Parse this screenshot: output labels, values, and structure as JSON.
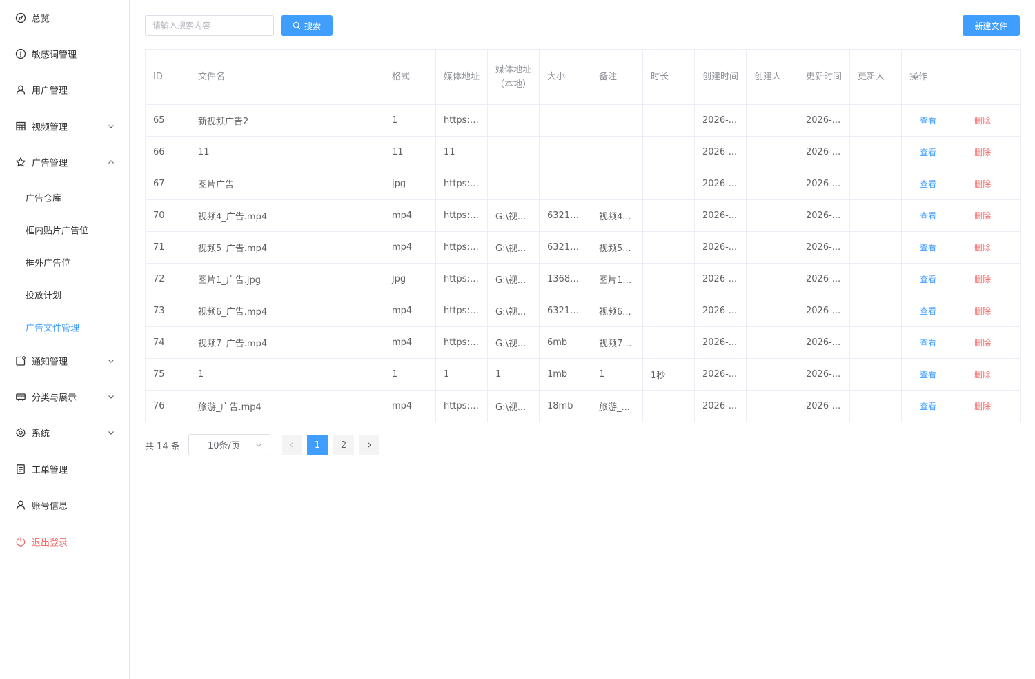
{
  "sidebar": {
    "items": [
      {
        "label": "总览"
      },
      {
        "label": "敏感词管理"
      },
      {
        "label": "用户管理"
      },
      {
        "label": "视频管理"
      },
      {
        "label": "广告管理"
      },
      {
        "label": "通知管理"
      },
      {
        "label": "分类与展示"
      },
      {
        "label": "系统"
      },
      {
        "label": "工单管理"
      },
      {
        "label": "账号信息"
      },
      {
        "label": "退出登录"
      }
    ],
    "ad_submenu": [
      {
        "label": "广告仓库"
      },
      {
        "label": "框内贴片广告位"
      },
      {
        "label": "框外广告位"
      },
      {
        "label": "投放计划"
      },
      {
        "label": "广告文件管理",
        "active": true
      }
    ]
  },
  "toolbar": {
    "search_placeholder": "请输入搜索内容",
    "search_label": "搜索",
    "new_file_label": "新建文件"
  },
  "table": {
    "headers": [
      "ID",
      "文件名",
      "格式",
      "媒体地址",
      "媒体地址（本地）",
      "大小",
      "备注",
      "时长",
      "创建时间",
      "创建人",
      "更新时间",
      "更新人",
      "操作"
    ],
    "view_label": "查看",
    "delete_label": "删除",
    "rows": [
      [
        "65",
        "新视频广告2",
        "1",
        "https:/...",
        "",
        "",
        "",
        "",
        "2026-...",
        "",
        "2026-...",
        ""
      ],
      [
        "66",
        "11",
        "11",
        "11",
        "",
        "",
        "",
        "",
        "2026-...",
        "",
        "2026-...",
        ""
      ],
      [
        "67",
        "图片广告",
        "jpg",
        "https:/...",
        "",
        "",
        "",
        "",
        "2026-...",
        "",
        "2026-...",
        ""
      ],
      [
        "70",
        "视频4_广告.mp4",
        "mp4",
        "https:/...",
        "G:\\视...",
        "63215...",
        "视频4...",
        "",
        "2026-...",
        "",
        "2026-...",
        ""
      ],
      [
        "71",
        "视频5_广告.mp4",
        "mp4",
        "https:/...",
        "G:\\视...",
        "63215...",
        "视频5...",
        "",
        "2026-...",
        "",
        "2026-...",
        ""
      ],
      [
        "72",
        "图片1_广告.jpg",
        "jpg",
        "https:/...",
        "G:\\视...",
        "13681...",
        "图片1_...",
        "",
        "2026-...",
        "",
        "2026-...",
        ""
      ],
      [
        "73",
        "视频6_广告.mp4",
        "mp4",
        "https:/...",
        "G:\\视...",
        "63215...",
        "视频6...",
        "",
        "2026-...",
        "",
        "2026-...",
        ""
      ],
      [
        "74",
        "视频7_广告.mp4",
        "mp4",
        "https:/...",
        "G:\\视...",
        "6mb",
        "视频7_...",
        "",
        "2026-...",
        "",
        "2026-...",
        ""
      ],
      [
        "75",
        "1",
        "1",
        "1",
        "1",
        "1mb",
        "1",
        "1秒",
        "2026-...",
        "",
        "2026-...",
        ""
      ],
      [
        "76",
        "旅游_广告.mp4",
        "mp4",
        "https:/...",
        "G:\\视...",
        "18mb",
        "旅游_...",
        "",
        "2026-...",
        "",
        "2026-...",
        ""
      ]
    ]
  },
  "pagination": {
    "total_label": "共 14 条",
    "page_size_label": "10条/页",
    "pages": [
      "1",
      "2"
    ],
    "current_page": "1"
  },
  "colors": {
    "primary": "#409eff",
    "danger": "#f56c6c",
    "border": "#ebeef5",
    "header_text": "#909399"
  }
}
